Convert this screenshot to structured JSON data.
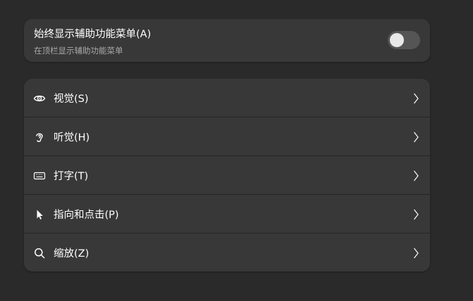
{
  "menu_toggle": {
    "title": "始终显示辅助功能菜单(A)",
    "subtitle": "在顶栏显示辅助功能菜单",
    "enabled": false
  },
  "categories": [
    {
      "label": "视觉(S)",
      "icon": "eye-icon"
    },
    {
      "label": "听觉(H)",
      "icon": "ear-icon"
    },
    {
      "label": "打字(T)",
      "icon": "keyboard-icon"
    },
    {
      "label": "指向和点击(P)",
      "icon": "pointer-icon"
    },
    {
      "label": "缩放(Z)",
      "icon": "magnifier-icon"
    }
  ],
  "colors": {
    "background": "#2a2a2a",
    "card": "#383838",
    "switch_off": "#555555",
    "subtitle_text": "#a8a8a8"
  }
}
